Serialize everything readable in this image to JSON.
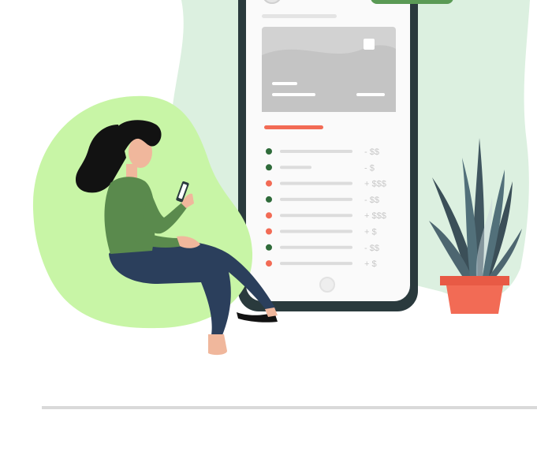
{
  "illustration": {
    "colors": {
      "back_blob": "#dcf0e0",
      "front_blob": "#c8f5a6",
      "phone_frame": "#2a3a3d",
      "phone_screen": "#fafafa",
      "card": "#d2d2d2",
      "accent_line": "#f26b55",
      "dot_green": "#2f6b3a",
      "dot_red": "#f26b55",
      "shirt": "#5a8a4d",
      "pants": "#2b3f5c",
      "hair": "#121212",
      "skin": "#f0b79c",
      "pot": "#f26b55",
      "plant": "#40565f",
      "divider": "#d9d9d9"
    },
    "transactions": [
      {
        "dot": "green",
        "amount": "- $$"
      },
      {
        "dot": "green",
        "amount": "- $"
      },
      {
        "dot": "red",
        "amount": "+ $$$"
      },
      {
        "dot": "green",
        "amount": "- $$"
      },
      {
        "dot": "red",
        "amount": "+ $$$"
      },
      {
        "dot": "red",
        "amount": "+ $"
      },
      {
        "dot": "green",
        "amount": "- $$"
      },
      {
        "dot": "red",
        "amount": "+ $"
      }
    ]
  }
}
